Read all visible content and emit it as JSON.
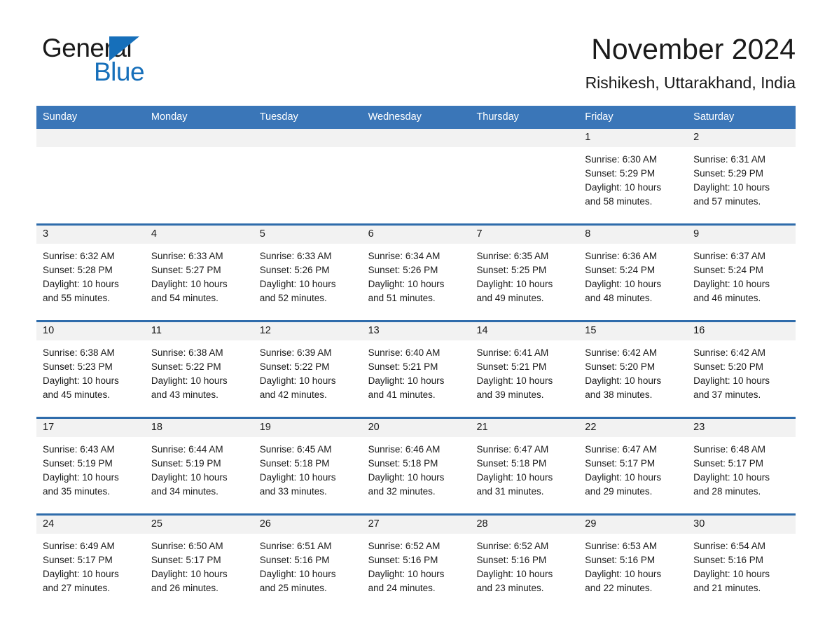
{
  "brand": {
    "word_one": "General",
    "word_two": "Blue",
    "triangle_color": "#166fba",
    "text_color": "#1b1b1b"
  },
  "header": {
    "month_title": "November 2024",
    "location": "Rishikesh, Uttarakhand, India"
  },
  "theme": {
    "header_blue": "#3a76b8",
    "row_divider_blue": "#2f6cab",
    "date_band_gray": "#f2f2f2",
    "text_color": "#1a1a1a"
  },
  "weekdays": [
    "Sunday",
    "Monday",
    "Tuesday",
    "Wednesday",
    "Thursday",
    "Friday",
    "Saturday"
  ],
  "weeks": [
    [
      {
        "date": "",
        "empty": true,
        "lines": []
      },
      {
        "date": "",
        "empty": true,
        "lines": []
      },
      {
        "date": "",
        "empty": true,
        "lines": []
      },
      {
        "date": "",
        "empty": true,
        "lines": []
      },
      {
        "date": "",
        "empty": true,
        "lines": []
      },
      {
        "date": "1",
        "empty": false,
        "lines": [
          "Sunrise: 6:30 AM",
          "Sunset: 5:29 PM",
          "Daylight: 10 hours",
          "and 58 minutes."
        ]
      },
      {
        "date": "2",
        "empty": false,
        "lines": [
          "Sunrise: 6:31 AM",
          "Sunset: 5:29 PM",
          "Daylight: 10 hours",
          "and 57 minutes."
        ]
      }
    ],
    [
      {
        "date": "3",
        "empty": false,
        "lines": [
          "Sunrise: 6:32 AM",
          "Sunset: 5:28 PM",
          "Daylight: 10 hours",
          "and 55 minutes."
        ]
      },
      {
        "date": "4",
        "empty": false,
        "lines": [
          "Sunrise: 6:33 AM",
          "Sunset: 5:27 PM",
          "Daylight: 10 hours",
          "and 54 minutes."
        ]
      },
      {
        "date": "5",
        "empty": false,
        "lines": [
          "Sunrise: 6:33 AM",
          "Sunset: 5:26 PM",
          "Daylight: 10 hours",
          "and 52 minutes."
        ]
      },
      {
        "date": "6",
        "empty": false,
        "lines": [
          "Sunrise: 6:34 AM",
          "Sunset: 5:26 PM",
          "Daylight: 10 hours",
          "and 51 minutes."
        ]
      },
      {
        "date": "7",
        "empty": false,
        "lines": [
          "Sunrise: 6:35 AM",
          "Sunset: 5:25 PM",
          "Daylight: 10 hours",
          "and 49 minutes."
        ]
      },
      {
        "date": "8",
        "empty": false,
        "lines": [
          "Sunrise: 6:36 AM",
          "Sunset: 5:24 PM",
          "Daylight: 10 hours",
          "and 48 minutes."
        ]
      },
      {
        "date": "9",
        "empty": false,
        "lines": [
          "Sunrise: 6:37 AM",
          "Sunset: 5:24 PM",
          "Daylight: 10 hours",
          "and 46 minutes."
        ]
      }
    ],
    [
      {
        "date": "10",
        "empty": false,
        "lines": [
          "Sunrise: 6:38 AM",
          "Sunset: 5:23 PM",
          "Daylight: 10 hours",
          "and 45 minutes."
        ]
      },
      {
        "date": "11",
        "empty": false,
        "lines": [
          "Sunrise: 6:38 AM",
          "Sunset: 5:22 PM",
          "Daylight: 10 hours",
          "and 43 minutes."
        ]
      },
      {
        "date": "12",
        "empty": false,
        "lines": [
          "Sunrise: 6:39 AM",
          "Sunset: 5:22 PM",
          "Daylight: 10 hours",
          "and 42 minutes."
        ]
      },
      {
        "date": "13",
        "empty": false,
        "lines": [
          "Sunrise: 6:40 AM",
          "Sunset: 5:21 PM",
          "Daylight: 10 hours",
          "and 41 minutes."
        ]
      },
      {
        "date": "14",
        "empty": false,
        "lines": [
          "Sunrise: 6:41 AM",
          "Sunset: 5:21 PM",
          "Daylight: 10 hours",
          "and 39 minutes."
        ]
      },
      {
        "date": "15",
        "empty": false,
        "lines": [
          "Sunrise: 6:42 AM",
          "Sunset: 5:20 PM",
          "Daylight: 10 hours",
          "and 38 minutes."
        ]
      },
      {
        "date": "16",
        "empty": false,
        "lines": [
          "Sunrise: 6:42 AM",
          "Sunset: 5:20 PM",
          "Daylight: 10 hours",
          "and 37 minutes."
        ]
      }
    ],
    [
      {
        "date": "17",
        "empty": false,
        "lines": [
          "Sunrise: 6:43 AM",
          "Sunset: 5:19 PM",
          "Daylight: 10 hours",
          "and 35 minutes."
        ]
      },
      {
        "date": "18",
        "empty": false,
        "lines": [
          "Sunrise: 6:44 AM",
          "Sunset: 5:19 PM",
          "Daylight: 10 hours",
          "and 34 minutes."
        ]
      },
      {
        "date": "19",
        "empty": false,
        "lines": [
          "Sunrise: 6:45 AM",
          "Sunset: 5:18 PM",
          "Daylight: 10 hours",
          "and 33 minutes."
        ]
      },
      {
        "date": "20",
        "empty": false,
        "lines": [
          "Sunrise: 6:46 AM",
          "Sunset: 5:18 PM",
          "Daylight: 10 hours",
          "and 32 minutes."
        ]
      },
      {
        "date": "21",
        "empty": false,
        "lines": [
          "Sunrise: 6:47 AM",
          "Sunset: 5:18 PM",
          "Daylight: 10 hours",
          "and 31 minutes."
        ]
      },
      {
        "date": "22",
        "empty": false,
        "lines": [
          "Sunrise: 6:47 AM",
          "Sunset: 5:17 PM",
          "Daylight: 10 hours",
          "and 29 minutes."
        ]
      },
      {
        "date": "23",
        "empty": false,
        "lines": [
          "Sunrise: 6:48 AM",
          "Sunset: 5:17 PM",
          "Daylight: 10 hours",
          "and 28 minutes."
        ]
      }
    ],
    [
      {
        "date": "24",
        "empty": false,
        "lines": [
          "Sunrise: 6:49 AM",
          "Sunset: 5:17 PM",
          "Daylight: 10 hours",
          "and 27 minutes."
        ]
      },
      {
        "date": "25",
        "empty": false,
        "lines": [
          "Sunrise: 6:50 AM",
          "Sunset: 5:17 PM",
          "Daylight: 10 hours",
          "and 26 minutes."
        ]
      },
      {
        "date": "26",
        "empty": false,
        "lines": [
          "Sunrise: 6:51 AM",
          "Sunset: 5:16 PM",
          "Daylight: 10 hours",
          "and 25 minutes."
        ]
      },
      {
        "date": "27",
        "empty": false,
        "lines": [
          "Sunrise: 6:52 AM",
          "Sunset: 5:16 PM",
          "Daylight: 10 hours",
          "and 24 minutes."
        ]
      },
      {
        "date": "28",
        "empty": false,
        "lines": [
          "Sunrise: 6:52 AM",
          "Sunset: 5:16 PM",
          "Daylight: 10 hours",
          "and 23 minutes."
        ]
      },
      {
        "date": "29",
        "empty": false,
        "lines": [
          "Sunrise: 6:53 AM",
          "Sunset: 5:16 PM",
          "Daylight: 10 hours",
          "and 22 minutes."
        ]
      },
      {
        "date": "30",
        "empty": false,
        "lines": [
          "Sunrise: 6:54 AM",
          "Sunset: 5:16 PM",
          "Daylight: 10 hours",
          "and 21 minutes."
        ]
      }
    ]
  ]
}
